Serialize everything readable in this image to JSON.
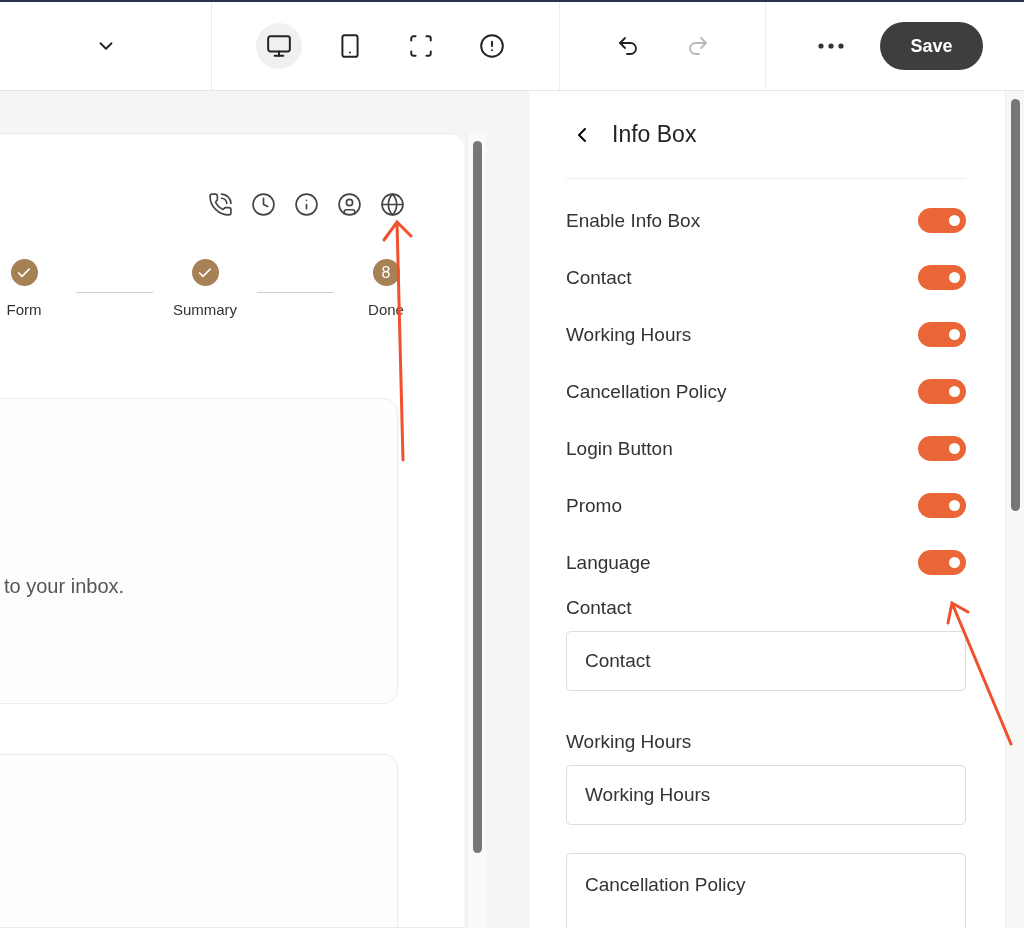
{
  "toolbar": {
    "devices": [
      {
        "kind": "desktop",
        "selected": true
      },
      {
        "kind": "mobile",
        "selected": false
      },
      {
        "kind": "fullscreen",
        "selected": false
      },
      {
        "kind": "alert",
        "selected": false
      }
    ],
    "history": [
      {
        "kind": "undo",
        "disabled": false
      },
      {
        "kind": "redo",
        "disabled": true
      }
    ],
    "save_button": "Save"
  },
  "preview": {
    "steps": [
      {
        "kind": "check",
        "label": "Form"
      },
      {
        "kind": "check",
        "label": "Summary"
      },
      {
        "kind": "number",
        "number": "8",
        "label": "Done"
      }
    ],
    "message": "to your inbox."
  },
  "panel": {
    "title": "Info Box",
    "toggles": [
      {
        "label": "Enable Info Box",
        "on": true
      },
      {
        "label": "Contact",
        "on": true
      },
      {
        "label": "Working Hours",
        "on": true
      },
      {
        "label": "Cancellation Policy",
        "on": true
      },
      {
        "label": "Login Button",
        "on": true
      },
      {
        "label": "Promo",
        "on": true
      },
      {
        "label": "Language",
        "on": true
      }
    ],
    "fields": [
      {
        "label": "Contact",
        "value": "Contact",
        "kind": "input"
      },
      {
        "label": "Working Hours",
        "value": "Working Hours",
        "kind": "input"
      },
      {
        "value": "Cancellation Policy",
        "kind": "textarea"
      }
    ]
  }
}
